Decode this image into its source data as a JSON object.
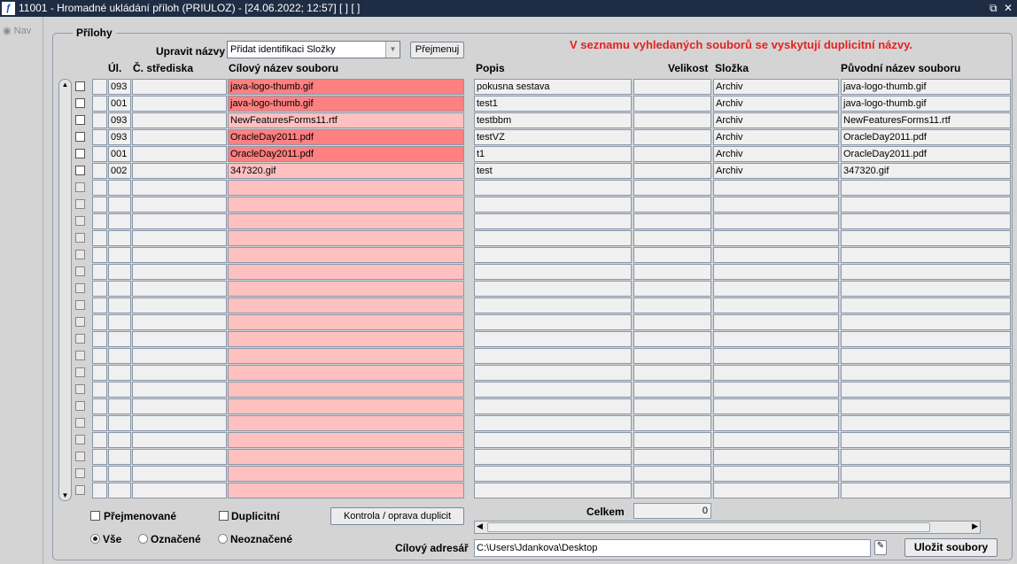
{
  "window": {
    "title": "11001 - Hromadné ukládání příloh (PRIULOZ) - [24.06.2022; 12:57]  [ ]  [ ]",
    "logo": "F"
  },
  "nav": {
    "label": "Nav"
  },
  "section": {
    "title": "Přílohy"
  },
  "rename": {
    "label": "Upravit názvy",
    "selected": "Přidat identifikaci Složky",
    "button": "Přejmenuj"
  },
  "warning": "V seznamu vyhledaných souborů se vyskytují duplicitní názvy.",
  "columns": {
    "ul": "Úl.",
    "stredisko": "Č. střediska",
    "cilovy": "Cílový název souboru",
    "popis": "Popis",
    "velikost": "Velikost",
    "slozka": "Složka",
    "puvodni": "Původní název souboru"
  },
  "rows": [
    {
      "ul": "093",
      "stredisko": "",
      "cilovy": "java-logo-thumb.gif",
      "dup": true,
      "popis": "pokusna sestava",
      "velikost": "",
      "slozka": "Archiv",
      "puvodni": "java-logo-thumb.gif"
    },
    {
      "ul": "001",
      "stredisko": "",
      "cilovy": "java-logo-thumb.gif",
      "dup": true,
      "popis": "test1",
      "velikost": "",
      "slozka": "Archiv",
      "puvodni": "java-logo-thumb.gif"
    },
    {
      "ul": "093",
      "stredisko": "",
      "cilovy": "NewFeaturesForms11.rtf",
      "dup": false,
      "popis": "testbbm",
      "velikost": "",
      "slozka": "Archiv",
      "puvodni": "NewFeaturesForms11.rtf"
    },
    {
      "ul": "093",
      "stredisko": "",
      "cilovy": "OracleDay2011.pdf",
      "dup": true,
      "popis": "testVZ",
      "velikost": "",
      "slozka": "Archiv",
      "puvodni": "OracleDay2011.pdf"
    },
    {
      "ul": "001",
      "stredisko": "",
      "cilovy": "OracleDay2011.pdf",
      "dup": true,
      "popis": "t1",
      "velikost": "",
      "slozka": "Archiv",
      "puvodni": "OracleDay2011.pdf"
    },
    {
      "ul": "002",
      "stredisko": "",
      "cilovy": "347320.gif",
      "dup": false,
      "popis": "test",
      "velikost": "",
      "slozka": "Archiv",
      "puvodni": "347320.gif"
    }
  ],
  "filters": {
    "prejmenovane": "Přejmenované",
    "duplicitni": "Duplicitní",
    "check_button": "Kontrola / oprava duplicit",
    "vse": "Vše",
    "oznacene": "Označené",
    "neoznacene": "Neoznačené"
  },
  "total": {
    "label": "Celkem",
    "value": "0"
  },
  "target": {
    "label": "Cílový adresář",
    "value": "C:\\Users\\Jdankova\\Desktop"
  },
  "save_button": "Uložit soubory"
}
